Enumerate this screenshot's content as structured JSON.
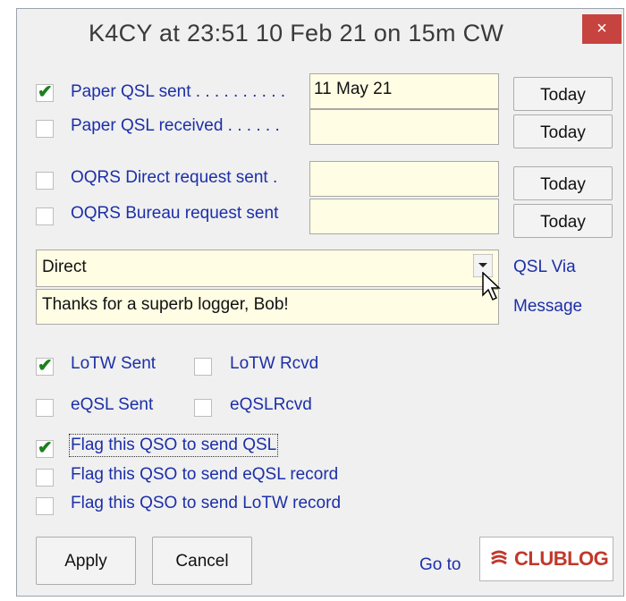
{
  "window": {
    "title": "K4CY at 23:51 10 Feb 21 on 15m CW",
    "close_glyph": "×"
  },
  "qsl": {
    "paper_sent": {
      "label": "Paper QSL sent . . . . . . . . . .",
      "checked": true,
      "date": "11 May 21",
      "today_label": "Today"
    },
    "paper_received": {
      "label": "Paper QSL received . . . . . .",
      "checked": false,
      "date": "",
      "today_label": "Today"
    },
    "oqrs_direct": {
      "label": "OQRS Direct request sent .",
      "checked": false,
      "date": "",
      "today_label": "Today"
    },
    "oqrs_bureau": {
      "label": "OQRS Bureau request sent",
      "checked": false,
      "date": "",
      "today_label": "Today"
    }
  },
  "qsl_via": {
    "value": "Direct",
    "label": "QSL Via"
  },
  "message": {
    "value": "Thanks for a superb logger, Bob!",
    "label": "Message"
  },
  "lotw": {
    "sent": {
      "label": "LoTW Sent",
      "checked": true
    },
    "rcvd": {
      "label": "LoTW Rcvd",
      "checked": false
    }
  },
  "eqsl": {
    "sent": {
      "label": "eQSL Sent",
      "checked": false
    },
    "rcvd": {
      "label": "eQSLRcvd",
      "checked": false
    }
  },
  "flags": {
    "send_qsl": {
      "label": "Flag this QSO to send QSL",
      "checked": true
    },
    "send_eqsl": {
      "label": "Flag this QSO to send eQSL record",
      "checked": false
    },
    "send_lotw": {
      "label": "Flag this QSO to send LoTW record",
      "checked": false
    }
  },
  "footer": {
    "apply_label": "Apply",
    "cancel_label": "Cancel",
    "goto_label": "Go to",
    "clublog_text": "CLUBLOG",
    "clublog_icon": "clublog-logo-icon"
  },
  "colors": {
    "label_blue": "#1c2fa8",
    "field_bg": "#fffde3",
    "close_red": "#c7433f",
    "check_green": "#1e7f1e",
    "clublog_red": "#c0392b"
  }
}
